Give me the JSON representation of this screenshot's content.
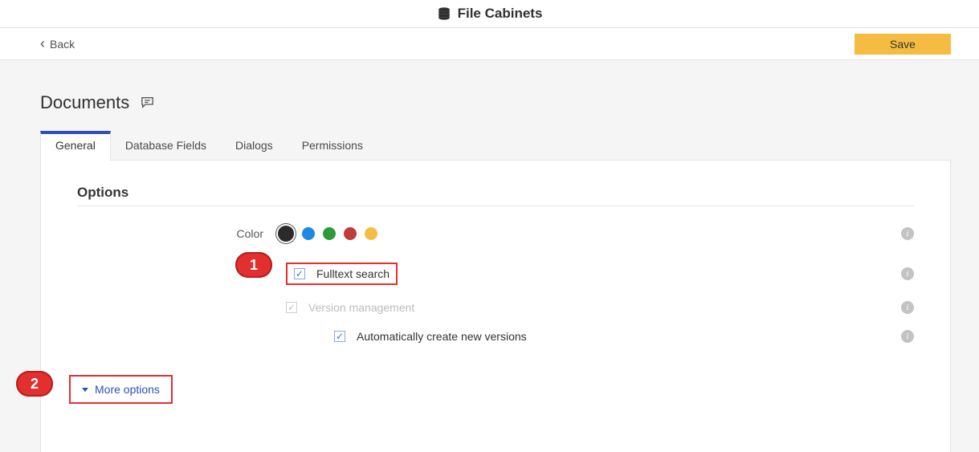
{
  "header": {
    "title": "File Cabinets"
  },
  "actions": {
    "back_label": "Back",
    "save_label": "Save"
  },
  "page": {
    "title": "Documents"
  },
  "tabs": [
    {
      "label": "General",
      "active": true
    },
    {
      "label": "Database Fields",
      "active": false
    },
    {
      "label": "Dialogs",
      "active": false
    },
    {
      "label": "Permissions",
      "active": false
    }
  ],
  "options": {
    "section_title": "Options",
    "color_label": "Color",
    "colors": {
      "selected": "#2b2b2b",
      "palette": [
        "#2b2b2b",
        "#1e88e5",
        "#2e9b3a",
        "#c23b3b",
        "#f4bd42"
      ]
    },
    "fulltext": {
      "label": "Fulltext search",
      "checked": true
    },
    "version_mgmt": {
      "label": "Version management",
      "checked": true,
      "disabled": true
    },
    "auto_versions": {
      "label": "Automatically create new versions",
      "checked": true
    }
  },
  "more_options_label": "More options",
  "annotations": {
    "callout1": "1",
    "callout2": "2"
  }
}
